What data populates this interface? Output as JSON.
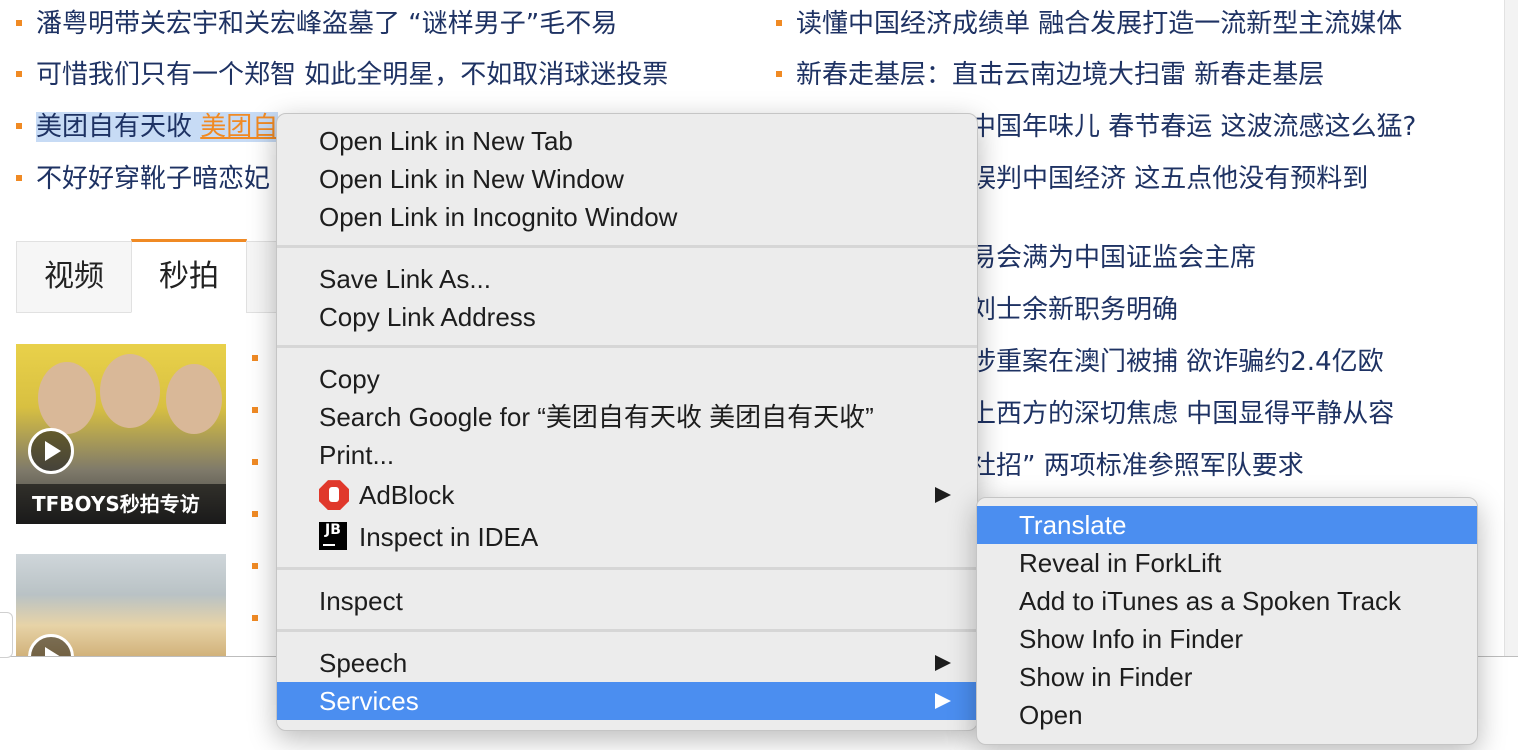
{
  "news_left": [
    "潘粤明带关宏宇和关宏峰盗墓了 “谜样男子”毛不易",
    "可惜我们只有一个郑智 如此全明星，不如取消球迷投票",
    "不好好穿靴子暗恋妃"
  ],
  "selected_news": {
    "part1": "美团自有天收",
    "part2": "美团自"
  },
  "news_right": [
    "读懂中国经济成绩单 融合发展打造一流新型主流媒体",
    "新春走基层：直击云南边境大扫雷 新春走基层",
    "中国年味儿 春节春运 这波流感这么猛?",
    "误判中国经济 这五点他没有预料到",
    "易会满为中国证监会主席",
    "刘士余新职务明确",
    "涉重案在澳门被捕 欲诈骗约2.4亿欧",
    "上西方的深切焦虑 中国显得平静从容",
    "社招” 两项标准参照军队要求"
  ],
  "tabs": [
    "视频",
    "秒拍"
  ],
  "thumbnails": [
    {
      "caption": "TFBOYS秒拍专访"
    }
  ],
  "context_menu": {
    "group1": [
      "Open Link in New Tab",
      "Open Link in New Window",
      "Open Link in Incognito Window"
    ],
    "group2": [
      "Save Link As...",
      "Copy Link Address"
    ],
    "group3": [
      "Copy",
      "Search Google for “美团自有天收 美团自有天收”",
      "Print...",
      "AdBlock",
      "Inspect in IDEA"
    ],
    "group4": [
      "Inspect"
    ],
    "group5": [
      "Speech",
      "Services"
    ]
  },
  "services_submenu": [
    "Translate",
    "Reveal in ForkLift",
    "Add to iTunes as a Spoken Track",
    "Show Info in Finder",
    "Show in Finder",
    "Open"
  ],
  "colors": {
    "accent": "#f08a24",
    "highlight": "#4b8ef0",
    "selection": "#c7dbf5",
    "link_text": "#1e3263"
  }
}
